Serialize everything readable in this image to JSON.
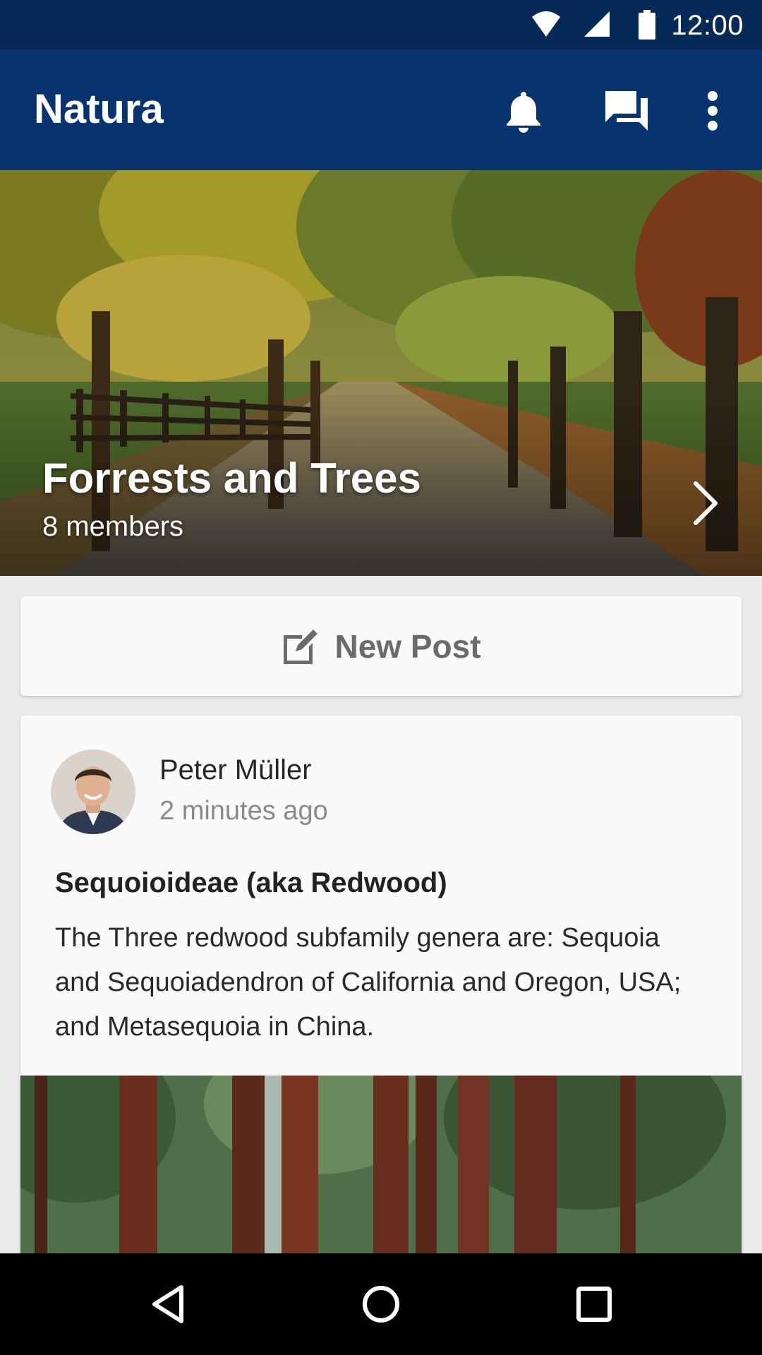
{
  "status_bar": {
    "time": "12:00",
    "icons": [
      "wifi-icon",
      "cell-signal-icon",
      "battery-icon"
    ]
  },
  "app_bar": {
    "title": "Natura",
    "actions": [
      "bell-icon",
      "chat-icon",
      "more-vert-icon"
    ],
    "background": "#07336e"
  },
  "group": {
    "title": "Forrests and Trees",
    "members": "8 members",
    "next_icon": "chevron-right-icon"
  },
  "new_post": {
    "label": "New Post",
    "icon": "edit-icon"
  },
  "post": {
    "author": "Peter Müller",
    "time": "2 minutes ago",
    "title": "Sequoioideae (aka Redwood)",
    "body": "The Three redwood subfamily genera are: Sequoia and Sequoiadendron of California and Oregon, USA; and Metasequoia in China."
  },
  "nav_bar": {
    "buttons": [
      "back-icon",
      "home-icon",
      "recents-icon"
    ]
  }
}
